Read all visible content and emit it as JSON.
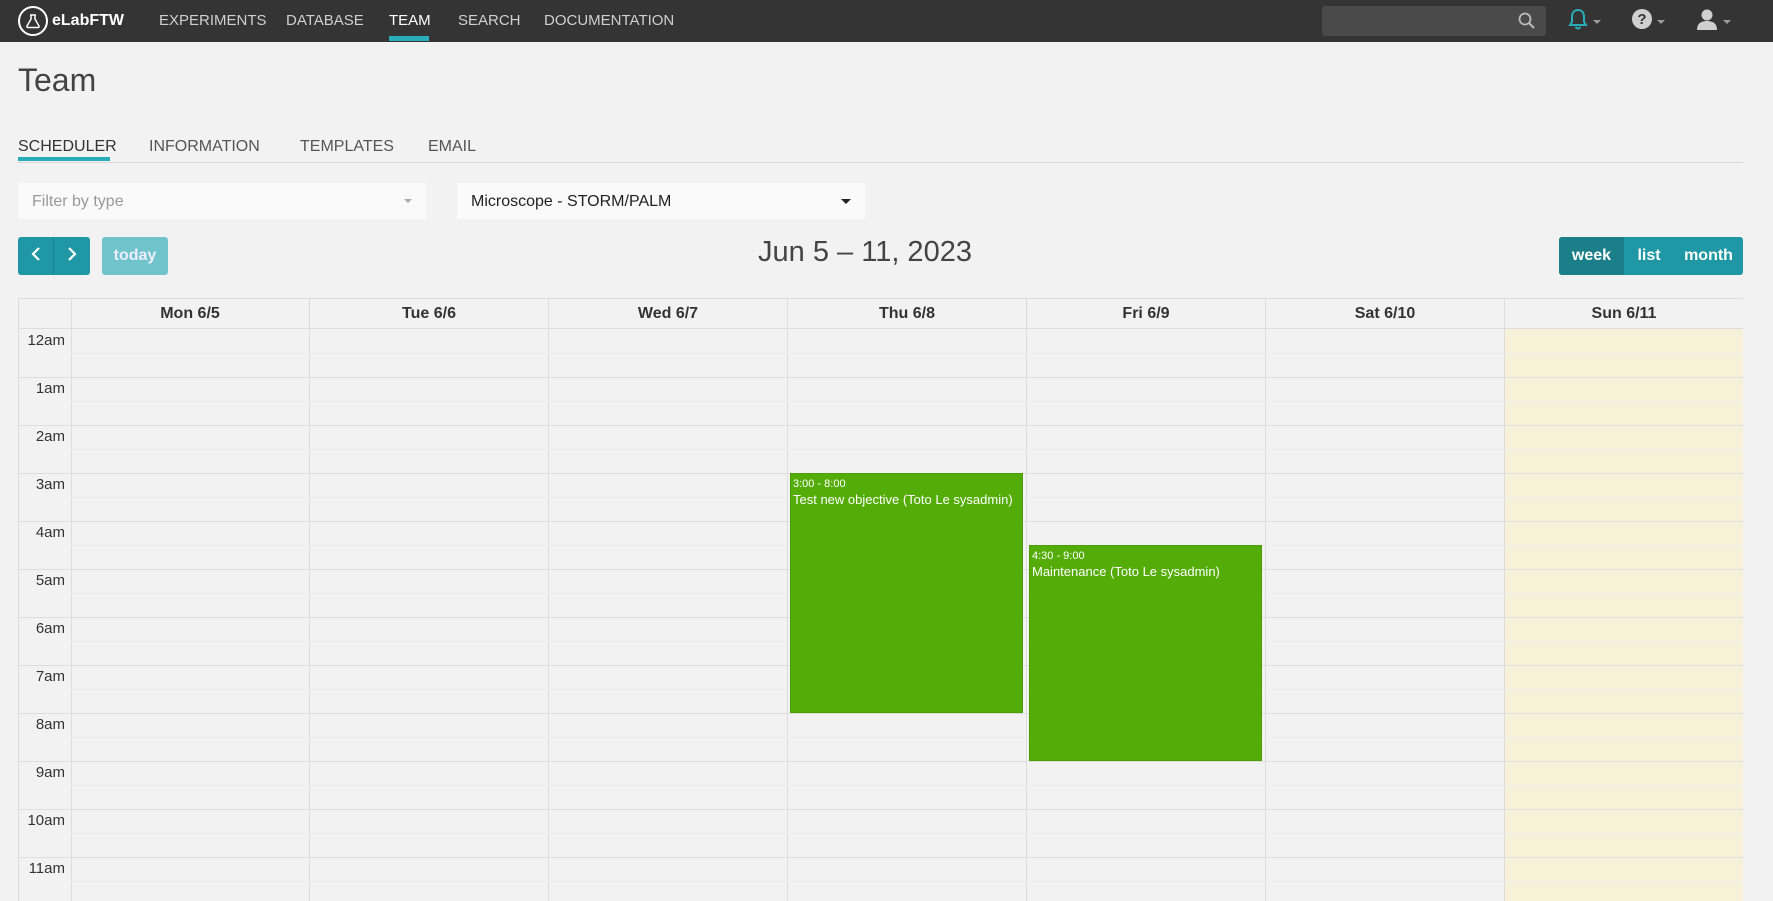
{
  "brand": {
    "name": "eLabFTW"
  },
  "nav": {
    "experiments": "EXPERIMENTS",
    "database": "DATABASE",
    "team": "TEAM",
    "search": "SEARCH",
    "documentation": "DOCUMENTATION"
  },
  "search": {
    "placeholder": ""
  },
  "icons": {
    "search": "search-icon",
    "bell": "bell-icon",
    "help": "help-icon",
    "user": "user-icon"
  },
  "colors": {
    "accent": "#29aeb9",
    "button": "#1f97a5",
    "event": "#54ac08",
    "today": "#f7f1d8",
    "topbar": "#343434"
  },
  "page": {
    "title": "Team"
  },
  "tabs": [
    "SCHEDULER",
    "INFORMATION",
    "TEMPLATES",
    "EMAIL"
  ],
  "filters": {
    "type_placeholder": "Filter by type",
    "item_selected": "Microscope - STORM/PALM"
  },
  "toolbar": {
    "prev": "‹",
    "next": "›",
    "today": "today",
    "title": "Jun 5 – 11, 2023",
    "views": [
      "week",
      "list",
      "month"
    ],
    "active_view": "week"
  },
  "calendar": {
    "days": [
      "Mon 6/5",
      "Tue 6/6",
      "Wed 6/7",
      "Thu 6/8",
      "Fri 6/9",
      "Sat 6/10",
      "Sun 6/11"
    ],
    "today_index": 6,
    "hours": [
      "12am",
      "1am",
      "2am",
      "3am",
      "4am",
      "5am",
      "6am",
      "7am",
      "8am",
      "9am",
      "10am",
      "11am"
    ],
    "events": [
      {
        "day": 3,
        "start": 3.0,
        "end": 8.0,
        "time": "3:00 - 8:00",
        "title": "Test new objective (Toto Le sysadmin)"
      },
      {
        "day": 4,
        "start": 4.5,
        "end": 9.0,
        "time": "4:30 - 9:00",
        "title": "Maintenance (Toto Le sysadmin)"
      }
    ]
  }
}
